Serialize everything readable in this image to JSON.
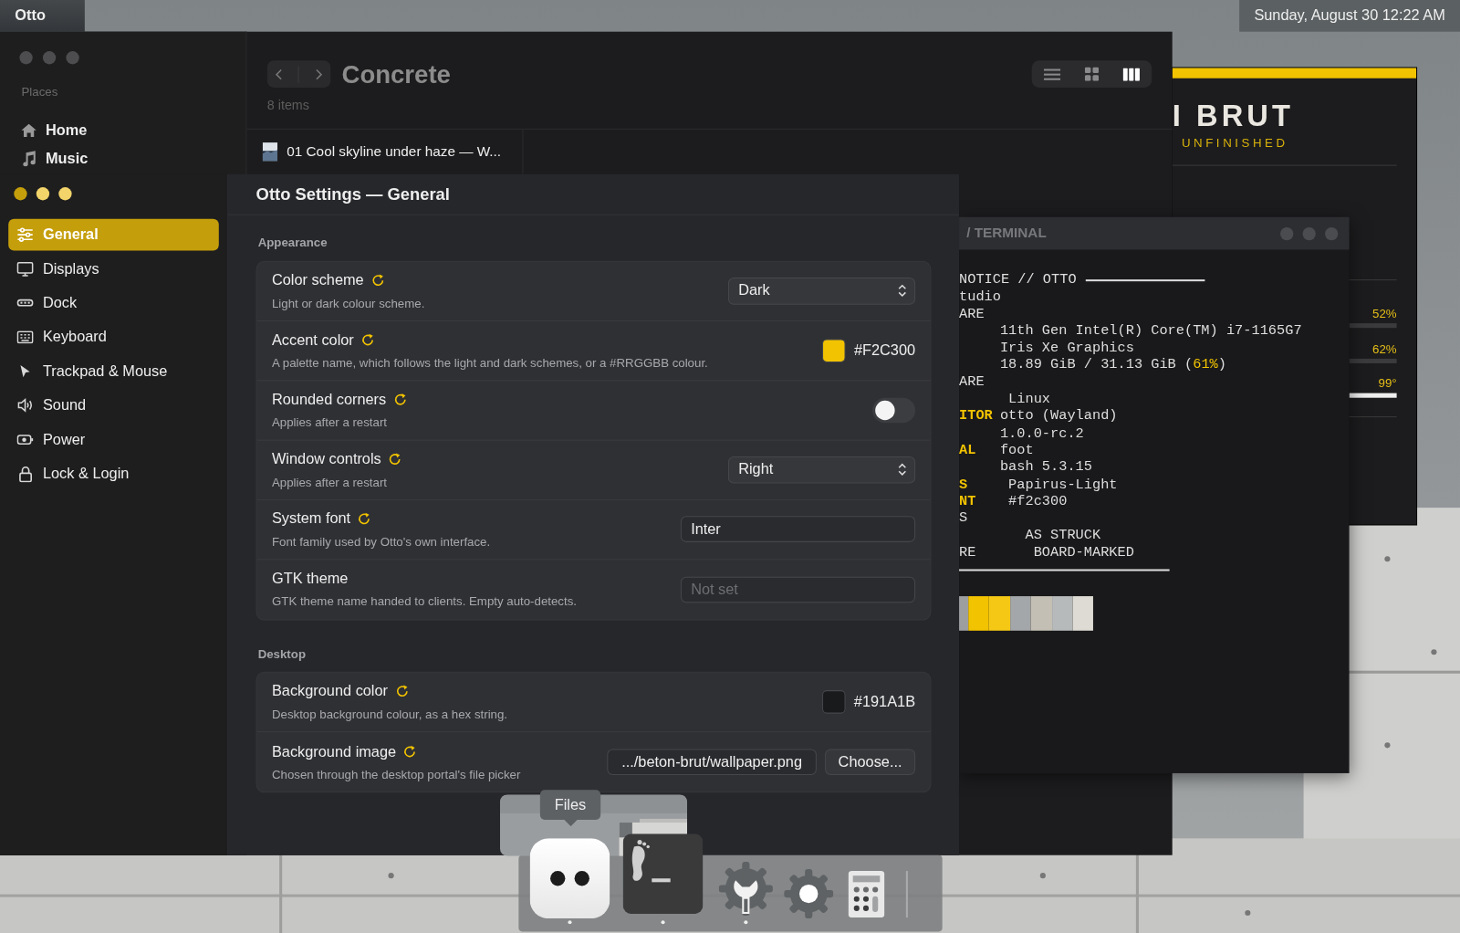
{
  "top_bar": {
    "app_name": "Otto",
    "clock": "Sunday, August 30  12:22 AM"
  },
  "files_window": {
    "places_label": "Places",
    "places": [
      {
        "label": "Home"
      },
      {
        "label": "Music"
      }
    ],
    "title": "Concrete",
    "item_count": "8 items",
    "views": [
      {
        "selected": false
      },
      {
        "selected": false
      },
      {
        "selected": true
      }
    ],
    "files": [
      {
        "name": "01 Cool skyline under haze — W..."
      }
    ]
  },
  "brut_window": {
    "title": "I BRUT",
    "subtitle": "UNFINISHED",
    "meters": [
      {
        "reading": "52%",
        "active": false
      },
      {
        "reading": "62%",
        "active": false
      },
      {
        "reading": "99°",
        "active": true
      }
    ]
  },
  "terminal": {
    "title": "/ TERMINAL",
    "lines": [
      {
        "kind": "heading",
        "label": "NOTICE // OTTO",
        "accent": false
      },
      {
        "kind": "field",
        "label": "tudio",
        "accent": false
      },
      {
        "kind": "field",
        "label": "ARE",
        "accent": false
      },
      {
        "kind": "field",
        "value": "11th Gen Intel(R) Core(TM) i7-1165G7"
      },
      {
        "kind": "field",
        "value": "Iris Xe Graphics"
      },
      {
        "kind": "field",
        "value": "18.89 GiB / 31.13 GiB (",
        "highlight": "61%",
        "suffix": ")"
      },
      {
        "kind": "field",
        "label": "ARE",
        "accent": false
      },
      {
        "kind": "field",
        "value": " Linux"
      },
      {
        "kind": "field",
        "label": "ITOR",
        "value": "otto (Wayland)",
        "accent": true
      },
      {
        "kind": "field",
        "value": "1.0.0-rc.2"
      },
      {
        "kind": "field",
        "label": "AL",
        "value": "foot",
        "accent": true
      },
      {
        "kind": "field",
        "value": "bash 5.3.15"
      },
      {
        "kind": "field",
        "label": "S",
        "value": " Papirus-Light",
        "accent": true
      },
      {
        "kind": "field",
        "label": "NT",
        "value": " #f2c300",
        "accent": true
      },
      {
        "kind": "field",
        "label": "S",
        "accent": false
      },
      {
        "kind": "field",
        "value": "   AS STRUCK"
      },
      {
        "kind": "field",
        "label": "RE",
        "value": "    BOARD-MARKED",
        "accent": false
      }
    ],
    "palette": [
      {
        "color": "#9c9ea0"
      },
      {
        "color": "#f2c300"
      },
      {
        "color": "#f5c816"
      },
      {
        "color": "#a4a7a9"
      },
      {
        "color": "#c4bfb4"
      },
      {
        "color": "#b7baba"
      },
      {
        "color": "#dddbd3"
      }
    ]
  },
  "settings": {
    "title": "Otto Settings — General",
    "nav": [
      {
        "label": "General",
        "selected": true
      },
      {
        "label": "Displays",
        "selected": false
      },
      {
        "label": "Dock",
        "selected": false
      },
      {
        "label": "Keyboard",
        "selected": false
      },
      {
        "label": "Trackpad & Mouse",
        "selected": false
      },
      {
        "label": "Sound",
        "selected": false
      },
      {
        "label": "Power",
        "selected": false
      },
      {
        "label": "Lock & Login",
        "selected": false
      }
    ],
    "sections": [
      {
        "title": "Appearance",
        "rows": [
          {
            "kind": "select",
            "title": "Color scheme",
            "description": "Light or dark colour scheme.",
            "modified": true,
            "value": "Dark"
          },
          {
            "kind": "color",
            "title": "Accent color",
            "description": "A palette name, which follows the light and dark schemes, or a #RRGGBB colour.",
            "modified": true,
            "value": "#F2C300",
            "color": "#f2c300"
          },
          {
            "kind": "toggle",
            "title": "Rounded corners",
            "description": "Applies after a restart",
            "modified": true,
            "on": false
          },
          {
            "kind": "select",
            "title": "Window controls",
            "description": "Applies after a restart",
            "modified": true,
            "value": "Right"
          },
          {
            "kind": "text",
            "title": "System font",
            "description": "Font family used by Otto's own interface.",
            "modified": true,
            "value": "Inter"
          },
          {
            "kind": "text",
            "title": "GTK theme",
            "description": "GTK theme name handed to clients. Empty auto-detects.",
            "modified": false,
            "placeholder": "Not set"
          }
        ]
      },
      {
        "title": "Desktop",
        "rows": [
          {
            "kind": "color",
            "title": "Background color",
            "description": "Desktop background colour, as a hex string.",
            "modified": true,
            "value": "#191A1B",
            "color": "#191a1b"
          },
          {
            "kind": "file",
            "title": "Background image",
            "description": "Chosen through the desktop portal's file picker",
            "modified": true,
            "value": ".../beton-brut/wallpaper.png",
            "button": "Choose..."
          }
        ]
      }
    ]
  },
  "dock": {
    "tooltip": "Files",
    "apps": [
      {
        "running": true
      },
      {
        "running": true
      },
      {
        "running": true
      },
      {
        "running": false
      },
      {
        "running": false
      }
    ]
  }
}
